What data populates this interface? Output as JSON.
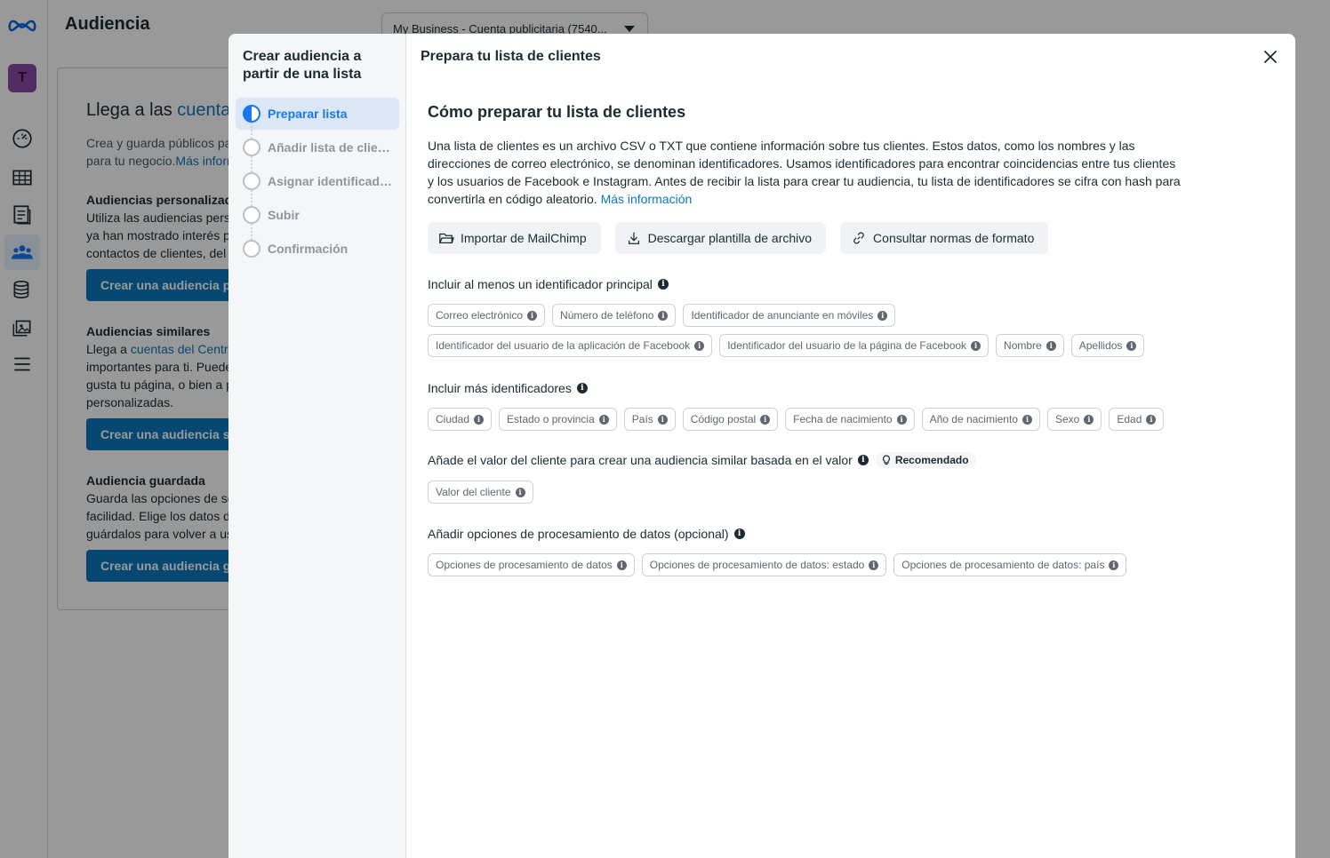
{
  "background": {
    "page_title": "Audiencia",
    "account_selector": "My Business - Cuenta publicitaria (7540...",
    "avatar_letter": "T",
    "card": {
      "heading_prefix": "Llega a las ",
      "heading_link": "cuentas del Centro de cuentas",
      "intro_line1": "Crea y guarda públicos para",
      "intro_line2_text": "para tu negocio.",
      "intro_link": "Más información",
      "custom_title": "Audiencias personalizadas",
      "custom_line1": "Utiliza las audiencias personalizadas",
      "custom_line2": "ya han mostrado interés por",
      "custom_line3": "contactos de clientes, del tráfico",
      "custom_button": "Crear una audiencia personalizada",
      "lookalike_title": "Audiencias similares",
      "lookalike_line1_text": "Llega a ",
      "lookalike_line1_link": "cuentas del Centro de cuentas",
      "lookalike_line2": "importantes para ti. Puedes",
      "lookalike_line3": "gusta tu página, o bien a personas",
      "lookalike_line4": "personalizadas.",
      "lookalike_button": "Crear una audiencia similar",
      "saved_title": "Audiencia guardada",
      "saved_line1": "Guarda las opciones de segmentación",
      "saved_line2": "facilidad. Elige los datos demográficos",
      "saved_line3": "guárdalos para volver a usarlos",
      "saved_button": "Crear una audiencia guardada"
    }
  },
  "modal": {
    "steps_title": "Crear audiencia a partir de una lista",
    "steps": [
      {
        "label": "Preparar lista"
      },
      {
        "label": "Añadir lista de clientes"
      },
      {
        "label": "Asignar identificadores"
      },
      {
        "label": "Subir"
      },
      {
        "label": "Confirmación"
      }
    ],
    "header_title": "Prepara tu lista de clientes",
    "section_title": "Cómo preparar tu lista de clientes",
    "description": "Una lista de clientes es un archivo CSV o TXT que contiene información sobre tus clientes. Estos datos, como los nombres y las direcciones de correo electrónico, se denominan identificadores. Usamos identificadores para encontrar coincidencias entre tus clientes y los usuarios de Facebook e Instagram. Antes de recibir la lista para crear tu audiencia, tu lista de identificadores se cifra con hash para convertirla en código aleatorio.",
    "description_link": "Más información",
    "actions": {
      "import": "Importar de MailChimp",
      "download": "Descargar plantilla de archivo",
      "format": "Consultar normas de formato"
    },
    "primary_title": "Incluir al menos un identificador principal",
    "primary_chips_row1": [
      "Correo electrónico",
      "Número de teléfono",
      "Identificador de anunciante en móviles"
    ],
    "primary_chips_row2": [
      "Identificador del usuario de la aplicación de Facebook",
      "Identificador del usuario de la página de Facebook",
      "Nombre",
      "Apellidos"
    ],
    "more_title": "Incluir más identificadores",
    "more_chips": [
      "Ciudad",
      "Estado o provincia",
      "País",
      "Código postal",
      "Fecha de nacimiento",
      "Año de nacimiento",
      "Sexo",
      "Edad"
    ],
    "value_title": "Añade el valor del cliente para crear una audiencia similar basada en el valor",
    "recommended_badge": "Recomendado",
    "value_chips": [
      "Valor del cliente"
    ],
    "processing_title": "Añadir opciones de procesamiento de datos (opcional)",
    "processing_chips": [
      "Opciones de procesamiento de datos",
      "Opciones de procesamiento de datos: estado",
      "Opciones de procesamiento de datos: país"
    ],
    "info_glyph": "i"
  },
  "colors": {
    "primary_blue": "#1877f2",
    "link_blue": "#0a78be",
    "text": "#1c2b33",
    "chip_border": "#cbd2d9"
  }
}
